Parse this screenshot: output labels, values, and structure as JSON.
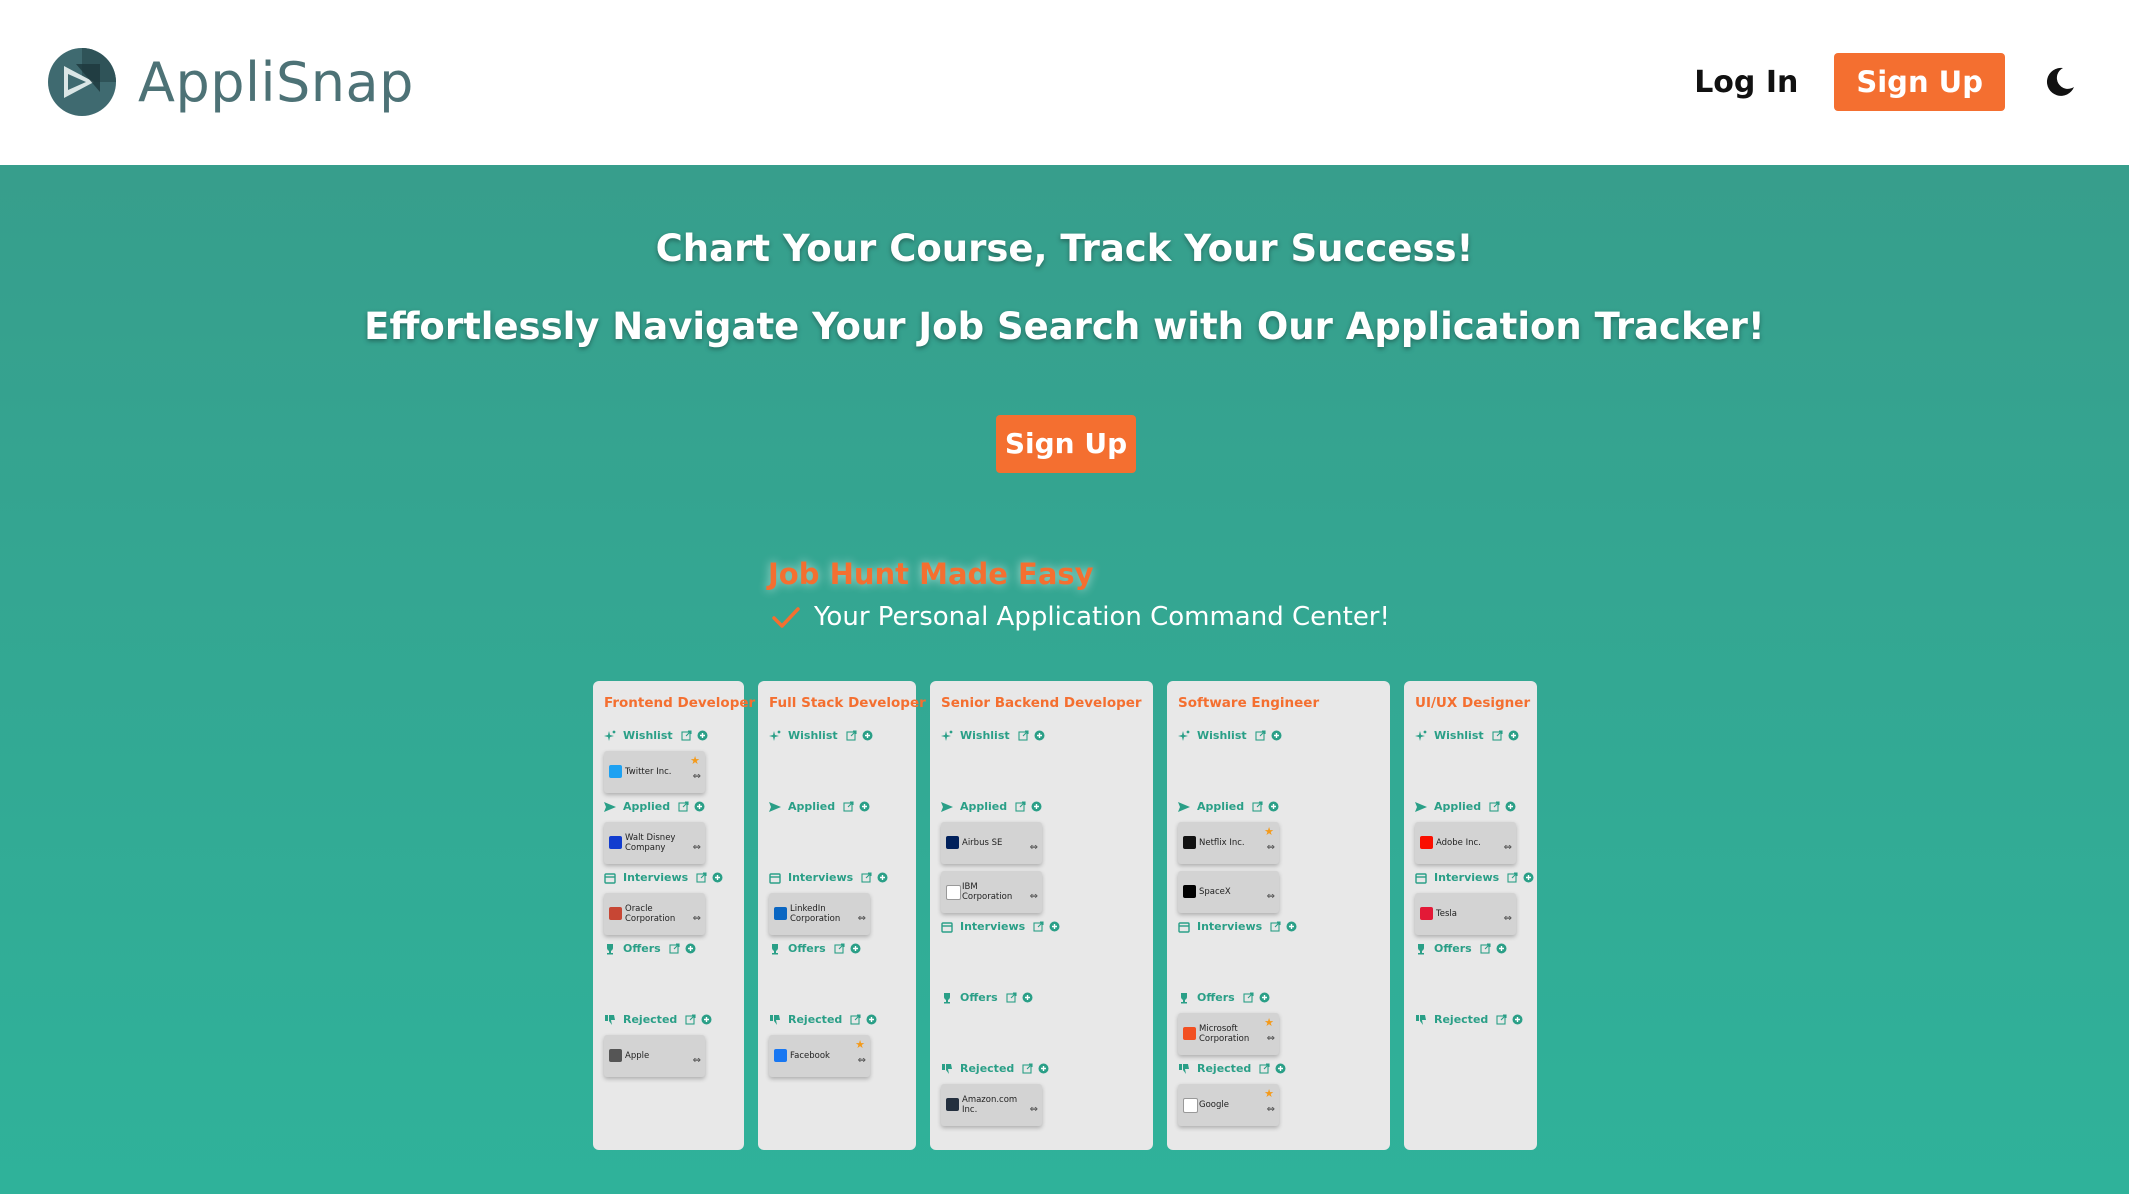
{
  "nav": {
    "brand": "AppliSnap",
    "login_label": "Log In",
    "signup_label": "Sign Up",
    "theme_icon": "moon-icon"
  },
  "hero": {
    "headline_1": "Chart Your Course, Track Your Success!",
    "headline_2": "Effortlessly Navigate Your Job Search with Our Application Tracker!",
    "signup_label": "Sign Up",
    "tagline_title": "Job Hunt Made Easy",
    "tagline_text": "Your Personal Application Command Center!"
  },
  "colors": {
    "accent": "#f46f30",
    "teal": "#2fb29a",
    "stage_green": "#2a9f87",
    "star": "#f49a1a"
  },
  "boards": [
    {
      "title": "Frontend Developer",
      "stages": [
        {
          "label": "Wishlist",
          "cards": [
            {
              "name": "Twitter Inc.",
              "starred": true
            }
          ]
        },
        {
          "label": "Applied",
          "cards": [
            {
              "name": "Walt Disney Company",
              "starred": false
            }
          ]
        },
        {
          "label": "Interviews",
          "cards": [
            {
              "name": "Oracle Corporation",
              "starred": false
            }
          ]
        },
        {
          "label": "Offers",
          "cards": []
        },
        {
          "label": "Rejected",
          "cards": [
            {
              "name": "Apple",
              "starred": false
            }
          ]
        }
      ]
    },
    {
      "title": "Full Stack Developer",
      "stages": [
        {
          "label": "Wishlist",
          "cards": []
        },
        {
          "label": "Applied",
          "cards": []
        },
        {
          "label": "Interviews",
          "cards": [
            {
              "name": "LinkedIn Corporation",
              "starred": false
            }
          ]
        },
        {
          "label": "Offers",
          "cards": []
        },
        {
          "label": "Rejected",
          "cards": [
            {
              "name": "Facebook",
              "starred": true
            }
          ]
        }
      ]
    },
    {
      "title": "Senior Backend Developer",
      "stages": [
        {
          "label": "Wishlist",
          "cards": []
        },
        {
          "label": "Applied",
          "cards": [
            {
              "name": "Airbus SE",
              "starred": false
            },
            {
              "name": "IBM Corporation",
              "starred": false
            }
          ]
        },
        {
          "label": "Interviews",
          "cards": []
        },
        {
          "label": "Offers",
          "cards": []
        },
        {
          "label": "Rejected",
          "cards": [
            {
              "name": "Amazon.com Inc.",
              "starred": false
            }
          ]
        }
      ]
    },
    {
      "title": "Software Engineer",
      "stages": [
        {
          "label": "Wishlist",
          "cards": []
        },
        {
          "label": "Applied",
          "cards": [
            {
              "name": "Netflix Inc.",
              "starred": true
            },
            {
              "name": "SpaceX",
              "starred": false
            }
          ]
        },
        {
          "label": "Interviews",
          "cards": []
        },
        {
          "label": "Offers",
          "cards": [
            {
              "name": "Microsoft Corporation",
              "starred": true
            }
          ]
        },
        {
          "label": "Rejected",
          "cards": [
            {
              "name": "Google",
              "starred": true
            }
          ]
        }
      ]
    },
    {
      "title": "UI/UX Designer",
      "stages": [
        {
          "label": "Wishlist",
          "cards": []
        },
        {
          "label": "Applied",
          "cards": [
            {
              "name": "Adobe Inc.",
              "starred": false
            }
          ]
        },
        {
          "label": "Interviews",
          "cards": [
            {
              "name": "Tesla",
              "starred": false
            }
          ]
        },
        {
          "label": "Offers",
          "cards": []
        },
        {
          "label": "Rejected",
          "cards": []
        }
      ]
    }
  ]
}
